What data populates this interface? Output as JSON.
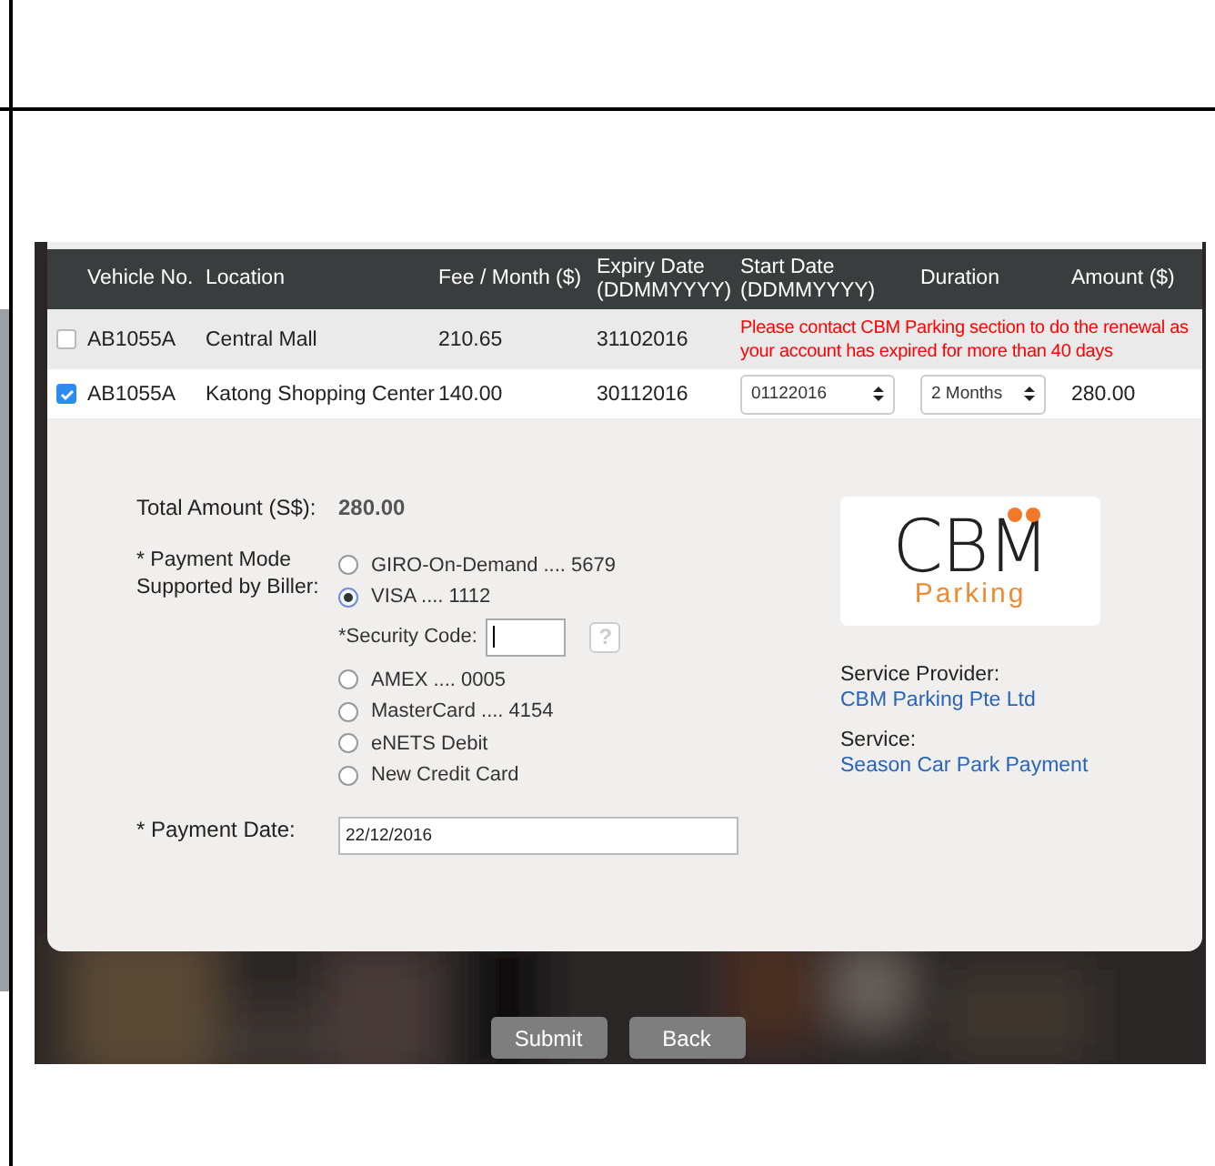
{
  "table": {
    "columns": [
      "Vehicle No.",
      "Location",
      "Fee / Month ($)",
      "Expiry Date (DDMMYYYY)",
      "Start Date (DDMMYYYY)",
      "Duration",
      "Amount ($)"
    ],
    "rows": [
      {
        "kind": "notice",
        "checked": false,
        "vehicle_no": "AB1055A",
        "location": "Central Mall",
        "fee": "210.65",
        "expiry": "31102016",
        "notice": "Please contact CBM Parking section to do the renewal as your account has expired for more than 40 days"
      },
      {
        "kind": "editable",
        "checked": true,
        "vehicle_no": "AB1055A",
        "location": "Katong Shopping Center",
        "fee": "140.00",
        "expiry": "30112016",
        "start_date": "01122016",
        "duration": "2 Months",
        "amount": "280.00"
      }
    ]
  },
  "payment": {
    "total_label": "Total Amount (S$):",
    "total": "280.00",
    "mode_label": "* Payment Mode Supported by Biller:",
    "options": [
      {
        "label": "GIRO-On-Demand .... 5679",
        "selected": false
      },
      {
        "label": "VISA .... 1112",
        "selected": true
      },
      {
        "label": "AMEX .... 0005",
        "selected": false
      },
      {
        "label": "MasterCard .... 4154",
        "selected": false
      },
      {
        "label": "eNETS Debit",
        "selected": false
      },
      {
        "label": "New Credit Card",
        "selected": false
      }
    ],
    "security_code": {
      "label": "*Security Code:",
      "help": "?"
    },
    "date_label": "* Payment Date:",
    "date": "22/12/2016"
  },
  "biller": {
    "logo": {
      "name": "CBM",
      "sub": "Parking"
    },
    "provider_label": "Service Provider:",
    "provider": "CBM Parking Pte Ltd",
    "service_label": "Service:",
    "service": "Season Car Park Payment"
  },
  "buttons": [
    "Submit",
    "Back"
  ]
}
